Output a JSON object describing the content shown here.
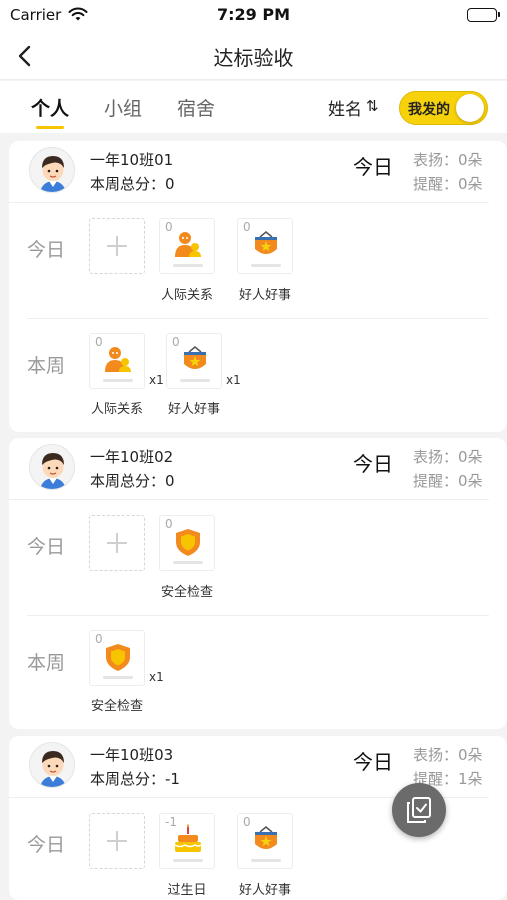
{
  "status_bar": {
    "carrier": "Carrier",
    "time": "7:29 PM"
  },
  "nav": {
    "title": "达标验收"
  },
  "tabs": [
    {
      "label": "个人",
      "active": true
    },
    {
      "label": "小组",
      "active": false
    },
    {
      "label": "宿舍",
      "active": false
    }
  ],
  "sort": {
    "label": "姓名",
    "icon": "⇅"
  },
  "toggle": {
    "label": "我发的",
    "on": true
  },
  "colors": {
    "accent": "#f7d10a",
    "icon_orange": "#f28a1e"
  },
  "cards": [
    {
      "class_name": "一年10班01",
      "week_total": "本周总分：0",
      "today_label": "今日",
      "praise": "表扬：0朵",
      "remind": "提醒：0朵",
      "today": {
        "row_label": "今日",
        "awards": [
          {
            "count": "0",
            "name": "人际关系",
            "icon": "person-icon"
          },
          {
            "count": "0",
            "name": "好人好事",
            "icon": "star-banner-icon"
          }
        ]
      },
      "week": {
        "row_label": "本周",
        "awards": [
          {
            "count": "0",
            "name": "人际关系",
            "icon": "person-icon",
            "mult": "x1"
          },
          {
            "count": "0",
            "name": "好人好事",
            "icon": "star-banner-icon",
            "mult": "x1"
          }
        ]
      }
    },
    {
      "class_name": "一年10班02",
      "week_total": "本周总分：0",
      "today_label": "今日",
      "praise": "表扬：0朵",
      "remind": "提醒：0朵",
      "today": {
        "row_label": "今日",
        "awards": [
          {
            "count": "0",
            "name": "安全检查",
            "icon": "shield-icon"
          }
        ]
      },
      "week": {
        "row_label": "本周",
        "awards": [
          {
            "count": "0",
            "name": "安全检查",
            "icon": "shield-icon",
            "mult": "x1"
          }
        ]
      }
    },
    {
      "class_name": "一年10班03",
      "week_total": "本周总分：-1",
      "today_label": "今日",
      "praise": "表扬：0朵",
      "remind": "提醒：1朵",
      "today": {
        "row_label": "今日",
        "awards": [
          {
            "count": "-1",
            "name": "过生日",
            "icon": "cake-icon"
          },
          {
            "count": "0",
            "name": "好人好事",
            "icon": "star-banner-icon"
          }
        ]
      }
    }
  ]
}
